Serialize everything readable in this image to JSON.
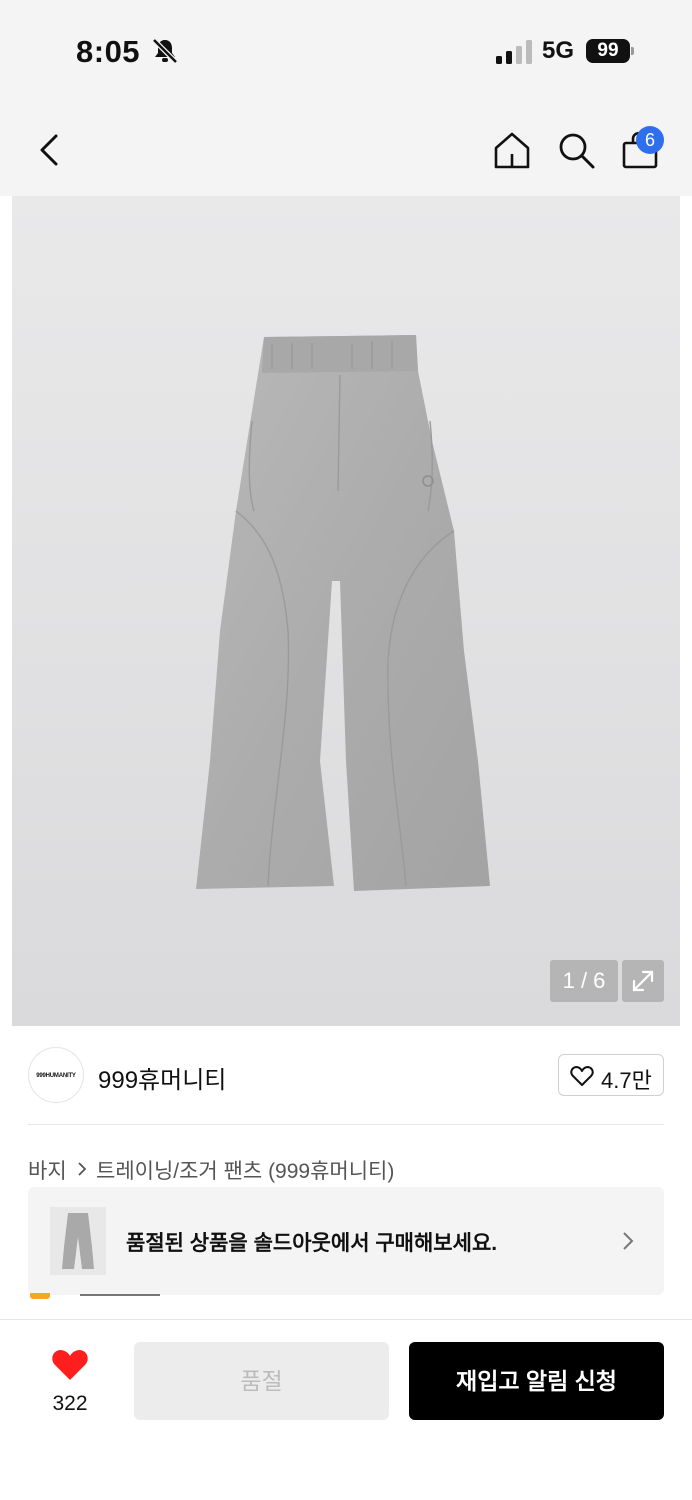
{
  "status_bar": {
    "time": "8:05",
    "network": "5G",
    "battery": "99",
    "icons": [
      "bell-off-icon",
      "signal-icon",
      "battery-icon"
    ]
  },
  "nav": {
    "cart_count": "6",
    "icons": [
      "back-icon",
      "home-icon",
      "search-icon",
      "cart-icon"
    ]
  },
  "gallery": {
    "counter": "1 / 6",
    "background": "#e2e2e3",
    "icons": [
      "expand-icon"
    ]
  },
  "brand": {
    "logo_text": "999HUMANITY",
    "name": "999휴머니티",
    "likes": "4.7만"
  },
  "breadcrumb": {
    "category": "바지",
    "subcategory": "트레이닝/조거 팬츠 (999휴머니티)"
  },
  "soldout_banner": {
    "message": "품절된 상품을 솔드아웃에서 구매해보세요."
  },
  "bottom_bar": {
    "like_count": "322",
    "soldout_label": "품절",
    "restock_label": "재입고 알림 신청"
  },
  "colors": {
    "accent_red": "#ff1e1e",
    "badge_blue": "#2f6fed",
    "cta_black": "#000000"
  }
}
